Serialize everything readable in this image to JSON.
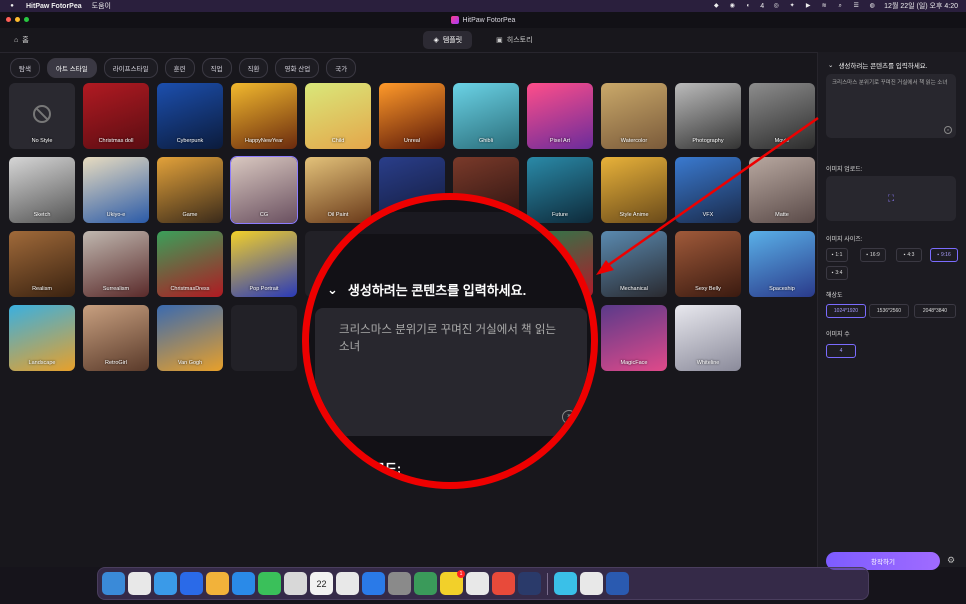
{
  "menubar": {
    "app_name": "HitPaw FotorPea",
    "menu_help": "도움이",
    "badge_count": "4",
    "clock": "12월 22일 (일) 오후 4:20"
  },
  "window": {
    "title": "HitPaw FotorPea",
    "home_label": "홈",
    "tab_templates": "템플릿",
    "tab_history": "히스토리"
  },
  "categories": [
    "탐색",
    "아트 스타일",
    "라이프스타일",
    "훈련",
    "직업",
    "직환",
    "영화 산업",
    "국가"
  ],
  "styles": [
    {
      "label": "No Style",
      "bg": "#2a2930"
    },
    {
      "label": "Christmas doll",
      "bg": "linear-gradient(160deg,#b11a22,#5a0d12)"
    },
    {
      "label": "Cyberpunk",
      "bg": "linear-gradient(160deg,#1c4fae,#0b1b3b)"
    },
    {
      "label": "HappyNewYear",
      "bg": "linear-gradient(160deg,#f2b92e,#6a2a0e)"
    },
    {
      "label": "Child",
      "bg": "linear-gradient(160deg,#d9e87a,#e4a64a)"
    },
    {
      "label": "Unreal",
      "bg": "linear-gradient(160deg,#ff9a2a,#5a1708)"
    },
    {
      "label": "Ghibli",
      "bg": "linear-gradient(160deg,#6bd3e6,#2a6d7a)"
    },
    {
      "label": "Pixel Art",
      "bg": "linear-gradient(160deg,#ff4e8a,#6a2c9b)"
    },
    {
      "label": "Watercolor",
      "bg": "linear-gradient(160deg,#caa96a,#7a5a3a)"
    },
    {
      "label": "Photography",
      "bg": "linear-gradient(160deg,#bbbbbb,#333)"
    },
    {
      "label": "Movie",
      "bg": "linear-gradient(160deg,#8d8d8d,#2c2c2c)"
    },
    {
      "label": "Sketch",
      "bg": "linear-gradient(160deg,#d6d6d6,#555)"
    },
    {
      "label": "Ukiyo-e",
      "bg": "linear-gradient(160deg,#e8dcc0,#2a5aa8)"
    },
    {
      "label": "Game",
      "bg": "linear-gradient(160deg,#e3a23a,#3a2a1a)"
    },
    {
      "label": "CG",
      "bg": "linear-gradient(160deg,#d9c8c0,#6a5060)"
    },
    {
      "label": "Oil Paint",
      "bg": "linear-gradient(160deg,#e3c27a,#6a3a1a)"
    },
    {
      "label": "",
      "bg": "linear-gradient(160deg,#2a3e8a,#121a3a)"
    },
    {
      "label": "",
      "bg": "linear-gradient(160deg,#7a3a2a,#2a1210)"
    },
    {
      "label": "Future",
      "bg": "linear-gradient(160deg,#2a8aa8,#0e2a3a)"
    },
    {
      "label": "Style Anime",
      "bg": "linear-gradient(160deg,#e8b23a,#6a4a1a)"
    },
    {
      "label": "VFX",
      "bg": "linear-gradient(160deg,#3a7ad0,#1a2a4a)"
    },
    {
      "label": "Matte",
      "bg": "linear-gradient(160deg,#b8a8a0,#5a4a48)"
    },
    {
      "label": "Realism",
      "bg": "linear-gradient(160deg,#a06a3a,#3a2210)"
    },
    {
      "label": "Surrealism",
      "bg": "linear-gradient(160deg,#c0b8b0,#5a2a2a)"
    },
    {
      "label": "ChristmasDress",
      "bg": "linear-gradient(160deg,#3aa05a,#b01a22)"
    },
    {
      "label": "Pop Portrait",
      "bg": "linear-gradient(160deg,#f2d02a,#2a3ab8)"
    },
    {
      "label": "",
      "bg": "#222127"
    },
    {
      "label": "",
      "bg": "#222127"
    },
    {
      "label": "",
      "bg": "linear-gradient(160deg,#3a6a8a,#1a2a3a)"
    },
    {
      "label": "ChristmasTeeBo",
      "bg": "linear-gradient(160deg,#2a7a4a,#b01a2a)"
    },
    {
      "label": "Mechanical",
      "bg": "linear-gradient(160deg,#5a8ab0,#2a2a30)"
    },
    {
      "label": "Sexy Belly",
      "bg": "linear-gradient(160deg,#a05a3a,#3a1a10)"
    },
    {
      "label": "Spaceship",
      "bg": "linear-gradient(160deg,#5ab0e8,#2a3a8a)"
    },
    {
      "label": "Landscape",
      "bg": "linear-gradient(160deg,#3ab0e0,#e8a02a)"
    },
    {
      "label": "RetroGirl",
      "bg": "linear-gradient(160deg,#c8a080,#5a3a2a)"
    },
    {
      "label": "Van Gogh",
      "bg": "linear-gradient(160deg,#3a6ab0,#e8a02a)"
    },
    {
      "label": "",
      "bg": "#222127"
    },
    {
      "label": "",
      "bg": "#222127"
    },
    {
      "label": "",
      "bg": "#222127"
    },
    {
      "label": "Summer",
      "bg": "linear-gradient(160deg,#4ac0e8,#e8d0a0)"
    },
    {
      "label": "Disney",
      "bg": "linear-gradient(160deg,#c0a070,#5a3a20)"
    },
    {
      "label": "MagicFace",
      "bg": "linear-gradient(160deg,#5a3a8a,#e04a8a)"
    },
    {
      "label": "Whiteline",
      "bg": "linear-gradient(160deg,#e8e8ee,#8a8a9a)"
    }
  ],
  "panel": {
    "prompt_title": "생성하려는 콘텐츠를 입력하세요.",
    "prompt_text": "크리스마스 분위기로 꾸며진 거실에서 책 읽는 소녀",
    "upload_label": "이미지 업로드:",
    "size_label": "이미지 사이즈:",
    "sizes": [
      "1:1",
      "16:9",
      "4:3",
      "9:16",
      "3:4"
    ],
    "resolution_label": "해상도",
    "resolutions": [
      "1024*1920",
      "1536*2560",
      "2048*3840"
    ],
    "count_label": "이미지 수",
    "count_value": "4",
    "generate_label": "창작하기"
  },
  "zoom": {
    "title": "생성하려는 콘텐츠를 입력하세요.",
    "text": "크리스마스 분위기로 꾸며진 거실에서 책 읽는 소녀",
    "footer": "코드:"
  },
  "dock": {
    "calendar_day": "22",
    "calendar_month": "12월",
    "badge": "1",
    "apps": [
      "#3a8ad8",
      "#e8e8e8",
      "#3a9ae8",
      "#2a6ae8",
      "#f2b23a",
      "#2a8ae8",
      "#3ac05a",
      "#d8d8d8",
      "#f2f2f2",
      "#e8e8e8",
      "#2a7ae8",
      "#8a8a8a",
      "#3a9a5a",
      "#f2d02a",
      "#e8e8e8",
      "#e84a3a",
      "#2a3a6a",
      "#3ac0e8",
      "#e8e8e8",
      "#2a5ab0"
    ]
  }
}
